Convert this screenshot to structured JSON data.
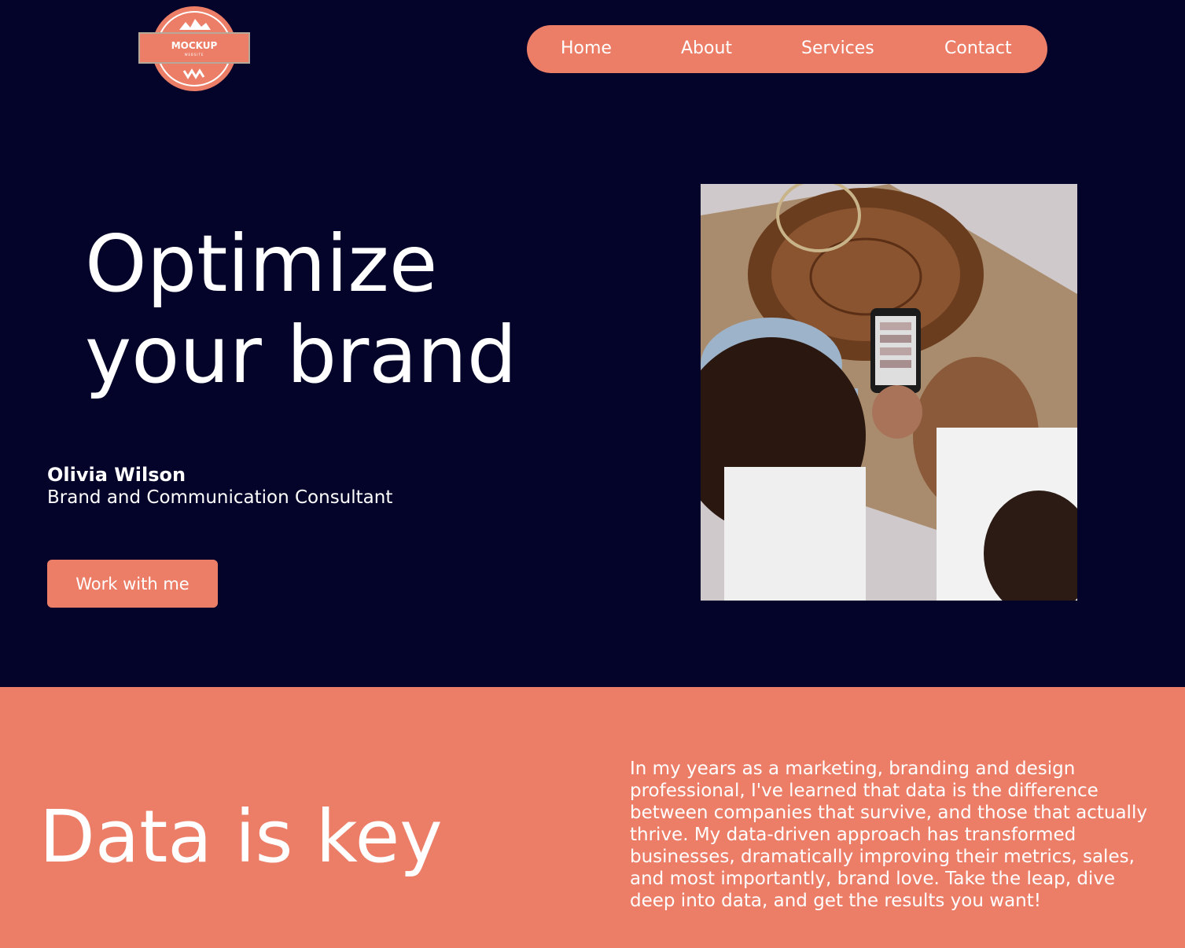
{
  "logo": {
    "text": "MOCKUP",
    "subtext": "WEBSITE",
    "icon": "logo-badge"
  },
  "nav": {
    "items": [
      {
        "label": "Home"
      },
      {
        "label": "About"
      },
      {
        "label": "Services"
      },
      {
        "label": "Contact"
      }
    ]
  },
  "hero": {
    "title_line1": "Optimize",
    "title_line2": "your brand",
    "name": "Olivia Wilson",
    "role": "Brand and Communication Consultant",
    "cta_label": "Work with me",
    "image_description_icon": "photo-people-with-phone"
  },
  "data_section": {
    "title": "Data is key",
    "body": "In my years as a marketing, branding and design professional, I've learned that data is the difference between companies that survive, and those that actually thrive. My data-driven approach has transformed businesses, dramatically improving their metrics, sales, and most importantly, brand love. Take the leap, dive deep into data, and get the results you want!"
  },
  "colors": {
    "background": "#04042a",
    "accent": "#ec7e68",
    "text": "#ffffff"
  }
}
